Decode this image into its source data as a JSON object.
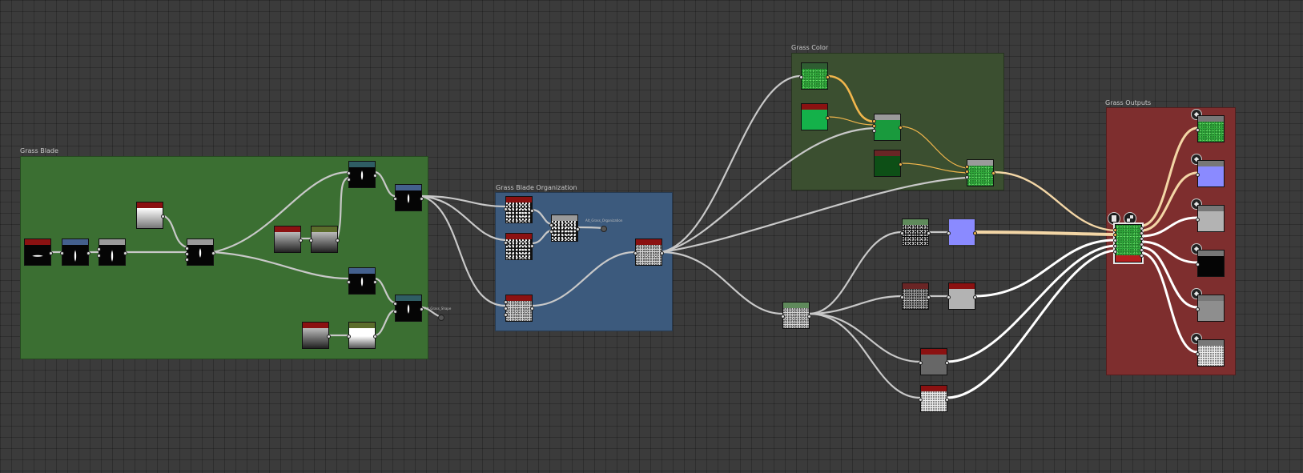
{
  "frames": {
    "grass_blade": {
      "title": "Grass Blade",
      "color": "#3b6f32"
    },
    "grass_blade_organization": {
      "title": "Grass Blade Organization",
      "color": "#3c5a7d"
    },
    "grass_color": {
      "title": "Grass Color",
      "color": "#3b4f30"
    },
    "grass_outputs": {
      "title": "Grass Outputs",
      "color": "#7e2e2e"
    }
  },
  "labels": {
    "alt_grass_shape": "Alt_Grass_Shape",
    "alt_grass_organization": "Alt_Grass_Organization"
  },
  "icons": [
    "node-thumbnail",
    "cube-icon",
    "document-icon",
    "checker-icon"
  ],
  "colors": {
    "link_default": "#c8c8c8",
    "link_color": "#f1b64c",
    "link_output": "#ffffff",
    "header_red": "#8b1111",
    "header_blue": "#44608d",
    "header_teal": "#2f5d64",
    "header_olive": "#5b6c2b",
    "header_grey": "#9a9a9a",
    "header_green_grey": "#5f8a5b"
  }
}
